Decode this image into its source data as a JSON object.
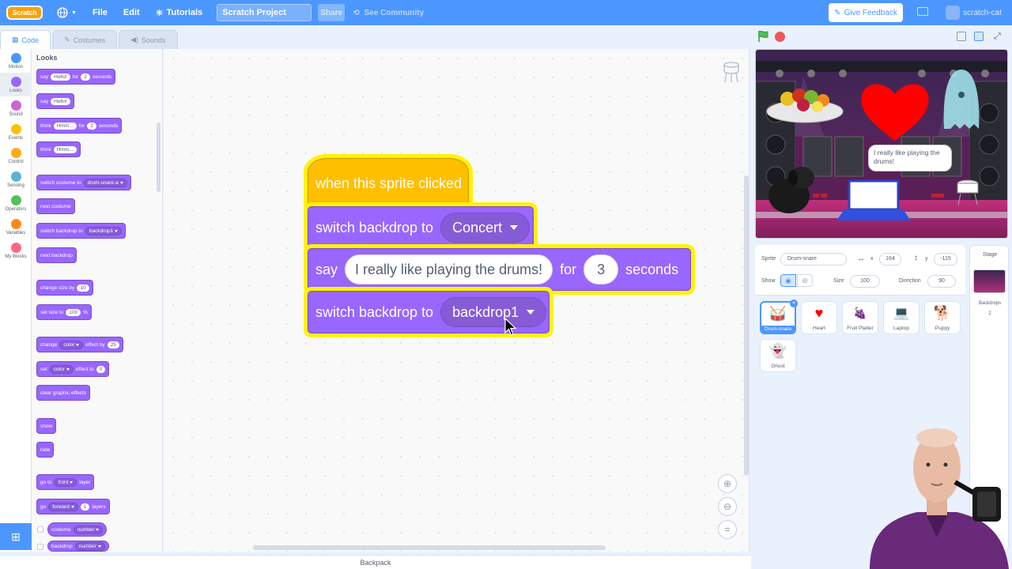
{
  "menubar": {
    "logo": "Scratch",
    "file": "File",
    "edit": "Edit",
    "tutorials": "Tutorials",
    "project_title": "Scratch Project",
    "share": "Share",
    "see_community": "See Community",
    "give_feedback": "Give Feedback",
    "username": "scratch-cat"
  },
  "tabs": {
    "code": "Code",
    "costumes": "Costumes",
    "sounds": "Sounds"
  },
  "categories": [
    {
      "label": "Motion",
      "color": "#4c97ff"
    },
    {
      "label": "Looks",
      "color": "#9966ff"
    },
    {
      "label": "Sound",
      "color": "#cf63cf"
    },
    {
      "label": "Events",
      "color": "#ffbf00"
    },
    {
      "label": "Control",
      "color": "#ffab19"
    },
    {
      "label": "Sensing",
      "color": "#5cb1d6"
    },
    {
      "label": "Operators",
      "color": "#59c059"
    },
    {
      "label": "Variables",
      "color": "#ff8c1a"
    },
    {
      "label": "My Blocks",
      "color": "#ff6680"
    }
  ],
  "palette": {
    "title": "Looks",
    "say_for": {
      "say": "say",
      "msg": "Hello!",
      "for": "for",
      "secs": "2",
      "seconds": "seconds"
    },
    "say": {
      "say": "say",
      "msg": "Hello!"
    },
    "think_for": {
      "think": "think",
      "msg": "Hmm...",
      "for": "for",
      "secs": "2",
      "seconds": "seconds"
    },
    "think": {
      "think": "think",
      "msg": "Hmm..."
    },
    "switch_costume": {
      "label": "switch costume to",
      "value": "drum-snare-a"
    },
    "next_costume": "next costume",
    "switch_backdrop": {
      "label": "switch backdrop to",
      "value": "backdrop1"
    },
    "next_backdrop": "next backdrop",
    "change_size": {
      "label": "change size by",
      "value": "10"
    },
    "set_size": {
      "label": "set size to",
      "value": "100",
      "unit": "%"
    },
    "change_effect": {
      "change": "change",
      "effect": "color",
      "by": "effect by",
      "value": "25"
    },
    "set_effect": {
      "set": "set",
      "effect": "color",
      "to": "effect to",
      "value": "0"
    },
    "clear_effects": "clear graphic effects",
    "show": "show",
    "hide": "hide",
    "go_to_layer": {
      "go_to": "go to",
      "layer": "front",
      "suffix": "layer"
    },
    "go_layers": {
      "go": "go",
      "dir": "forward",
      "value": "1",
      "suffix": "layers"
    },
    "costume_reporter": {
      "label": "costume",
      "value": "number"
    },
    "backdrop_reporter": {
      "label": "backdrop",
      "value": "number"
    }
  },
  "script": {
    "hat": "when this sprite clicked",
    "block1": {
      "label": "switch backdrop to",
      "value": "Concert"
    },
    "block2": {
      "say": "say",
      "message": "I really like playing the drums!",
      "for": "for",
      "secs": "3",
      "seconds": "seconds"
    },
    "block3": {
      "label": "switch backdrop to",
      "value": "backdrop1"
    }
  },
  "stage": {
    "speech": "I really like playing the drums!"
  },
  "sprite_info": {
    "sprite_label": "Sprite",
    "sprite_name": "Drum-snare",
    "x_label": "x",
    "x_value": "164",
    "y_label": "y",
    "y_value": "-115",
    "show_label": "Show",
    "size_label": "Size",
    "size_value": "100",
    "direction_label": "Direction",
    "direction_value": "90"
  },
  "sprites": [
    {
      "name": "Drum-snare",
      "icon": "drum-icon"
    },
    {
      "name": "Heart",
      "icon": "heart-icon"
    },
    {
      "name": "Fruit Platter",
      "icon": "fruit-icon"
    },
    {
      "name": "Laptop",
      "icon": "laptop-icon"
    },
    {
      "name": "Puppy",
      "icon": "puppy-icon"
    },
    {
      "name": "Ghost",
      "icon": "ghost-icon"
    }
  ],
  "stage_pane": {
    "title": "Stage",
    "backdrops_label": "Backdrops",
    "backdrops_count": "2"
  },
  "backpack": "Backpack"
}
